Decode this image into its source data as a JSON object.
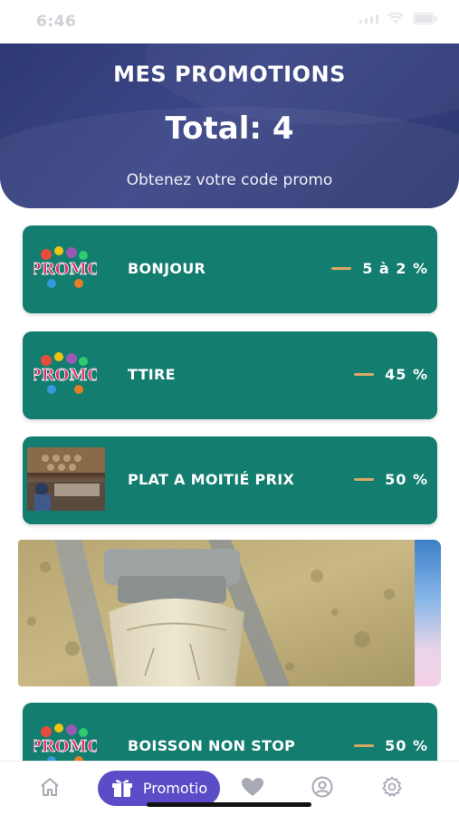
{
  "status_bar": {
    "time": "6:46"
  },
  "header": {
    "title": "MES PROMOTIONS",
    "total": "Total: 4",
    "subtitle": "Obtenez votre code promo"
  },
  "promos": [
    {
      "name": "BONJOUR",
      "value": "5 à 2 %",
      "thumb": "promo-logo"
    },
    {
      "name": "TTIRE",
      "value": "45 %",
      "thumb": "promo-logo"
    },
    {
      "name": "PLAT A MOITIÉ PRIX",
      "value": "50 %",
      "thumb": "photo"
    },
    {
      "name": "BOISSON NON STOP",
      "value": "50 %",
      "thumb": "promo-logo"
    }
  ],
  "promo_logo_text": "PROMO",
  "bottom_nav": {
    "items": [
      {
        "icon": "home-icon"
      },
      {
        "icon": "gift-icon",
        "label": "Promotio",
        "active": true
      },
      {
        "icon": "heart-icon"
      },
      {
        "icon": "user-circle-icon"
      },
      {
        "icon": "gear-icon"
      }
    ]
  },
  "colors": {
    "header": "#2f3a73",
    "card": "#137d6f",
    "accent_dash": "#d8a865",
    "nav_active": "#5b4dc8"
  }
}
